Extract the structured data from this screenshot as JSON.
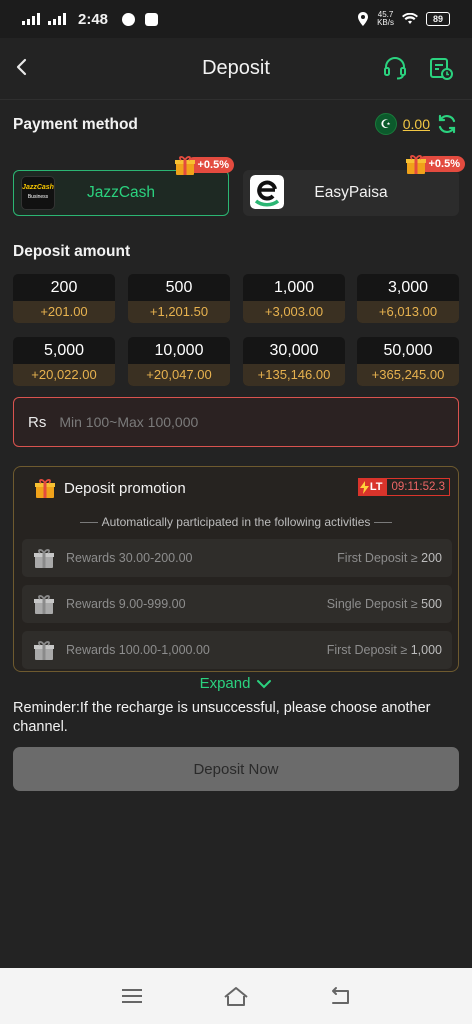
{
  "status_bar": {
    "time": "2:48",
    "net_speed_value": "45.7",
    "net_speed_unit": "KB/s",
    "battery": "89"
  },
  "header": {
    "title": "Deposit"
  },
  "payment": {
    "label": "Payment method",
    "balance": "0.00",
    "methods": [
      {
        "name": "JazzCash",
        "logo_text": "JazzCash",
        "logo_sub": "Business",
        "badge": "+0.5%",
        "selected": true
      },
      {
        "name": "EasyPaisa",
        "badge": "+0.5%",
        "selected": false
      }
    ]
  },
  "deposit": {
    "label": "Deposit amount",
    "amounts": [
      {
        "value": "200",
        "bonus": "+201.00"
      },
      {
        "value": "500",
        "bonus": "+1,201.50"
      },
      {
        "value": "1,000",
        "bonus": "+3,003.00"
      },
      {
        "value": "3,000",
        "bonus": "+6,013.00"
      },
      {
        "value": "5,000",
        "bonus": "+20,022.00"
      },
      {
        "value": "10,000",
        "bonus": "+20,047.00"
      },
      {
        "value": "30,000",
        "bonus": "+135,146.00"
      },
      {
        "value": "50,000",
        "bonus": "+365,245.00"
      }
    ],
    "currency": "Rs",
    "placeholder": "Min 100~Max 100,000"
  },
  "promotion": {
    "title": "Deposit promotion",
    "timer_tag": "LT",
    "timer": "09:11:52.3",
    "subtitle": "Automatically participated in the following activities",
    "rows": [
      {
        "reward": "Rewards 30.00-200.00",
        "condition": "First Deposit ≥",
        "threshold": "200"
      },
      {
        "reward": "Rewards 9.00-999.00",
        "condition": "Single Deposit ≥",
        "threshold": "500"
      },
      {
        "reward": "Rewards 100.00-1,000.00",
        "condition": "First Deposit ≥",
        "threshold": "1,000"
      }
    ],
    "expand_label": "Expand"
  },
  "reminder": "Reminder:If the recharge is unsuccessful, please choose another channel.",
  "deposit_button": "Deposit Now",
  "colors": {
    "accent_green": "#2bd27f",
    "bonus_gold": "#e7b24f",
    "alert_red": "#d9534f"
  }
}
